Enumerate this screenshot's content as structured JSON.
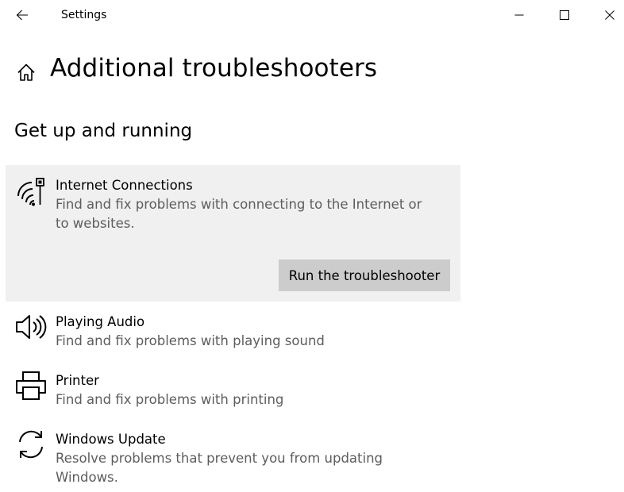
{
  "window": {
    "title": "Settings"
  },
  "page": {
    "title": "Additional troubleshooters",
    "section_title": "Get up and running"
  },
  "troubleshooters": [
    {
      "name": "Internet Connections",
      "description": "Find and fix problems with connecting to the Internet or to websites.",
      "icon": "wifi-network-icon",
      "expanded": true,
      "button_label": "Run the troubleshooter"
    },
    {
      "name": "Playing Audio",
      "description": "Find and fix problems with playing sound",
      "icon": "speaker-icon",
      "expanded": false
    },
    {
      "name": "Printer",
      "description": "Find and fix problems with printing",
      "icon": "printer-icon",
      "expanded": false
    },
    {
      "name": "Windows Update",
      "description": "Resolve problems that prevent you from updating Windows.",
      "icon": "sync-icon",
      "expanded": false
    }
  ],
  "colors": {
    "expanded_background": "#f0f0f0",
    "button_background": "#cccccc",
    "description_text": "#5d5d5d"
  }
}
